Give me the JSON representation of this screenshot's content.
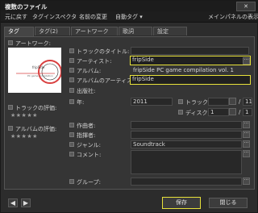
{
  "window": {
    "title": "複数のファイル",
    "close_label": "✕"
  },
  "menubar": {
    "items": [
      "元に戻す",
      "タグインスペクタ",
      "名前の変更",
      "自動タグ ▾"
    ],
    "right_item": "メインパネルの表示"
  },
  "tabs": [
    "タグ",
    "タグ(2)",
    "アートワーク",
    "歌詞",
    "設定"
  ],
  "left": {
    "artwork_label": "アートワーク:",
    "track_rating_label": "トラックの評価:",
    "album_rating_label": "アルバムの評価:",
    "stars": "★★★★★"
  },
  "fields": {
    "track_title": {
      "label": "トラックのタイトル:",
      "value": ""
    },
    "artist": {
      "label": "アーティスト:",
      "value": "fripSide"
    },
    "album": {
      "label": "アルバム:",
      "value": "fripSide PC game compilation vol. 1"
    },
    "album_artist": {
      "label": "アルバムのアーティスト:",
      "value": "fripSide"
    },
    "publisher": {
      "label": "出版社:",
      "value": ""
    },
    "year": {
      "label": "年:",
      "value": "2011"
    },
    "track": {
      "label": "トラック:",
      "value": "",
      "total": "11"
    },
    "disc": {
      "label": "ディスク:",
      "value": "1",
      "total": "1"
    },
    "composer": {
      "label": "作曲者:",
      "value": ""
    },
    "lyricist": {
      "label": "指揮者:",
      "value": ""
    },
    "genre": {
      "label": "ジャンル:",
      "value": "Soundtrack"
    },
    "comment": {
      "label": "コメント:",
      "value": ""
    },
    "group": {
      "label": "グループ:",
      "value": ""
    }
  },
  "slash": "/",
  "dots": "···",
  "nav": {
    "prev": "◀",
    "next": "▶"
  },
  "buttons": {
    "save": "保存",
    "close": "閉じる"
  }
}
